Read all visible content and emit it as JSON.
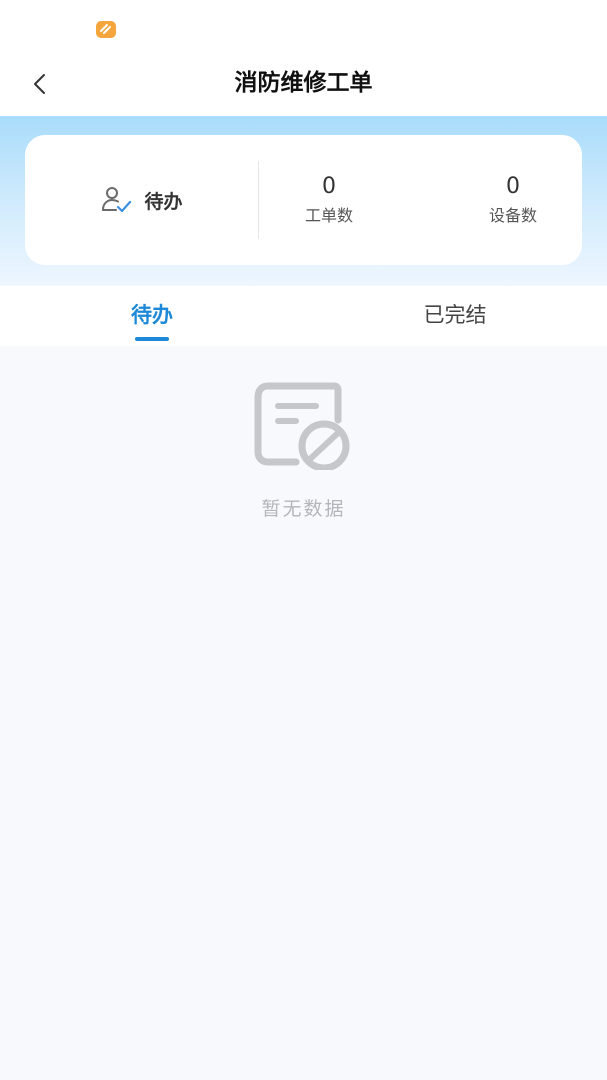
{
  "header": {
    "title": "消防维修工单",
    "back_icon": "chevron-left-icon"
  },
  "summary": {
    "status_label": "待办",
    "status_icon": "user-check-icon",
    "order_count": "0",
    "order_label": "工单数",
    "device_count": "0",
    "device_label": "设备数"
  },
  "tabs": [
    {
      "label": "待办",
      "active": true
    },
    {
      "label": "已完结",
      "active": false
    }
  ],
  "empty_state": {
    "text": "暂无数据",
    "icon": "no-data-icon"
  },
  "colors": {
    "accent": "#1e88d8",
    "badge": "#f4a63c",
    "gradient_top": "#a9dcfb",
    "page_bg": "#f7f9fd"
  }
}
